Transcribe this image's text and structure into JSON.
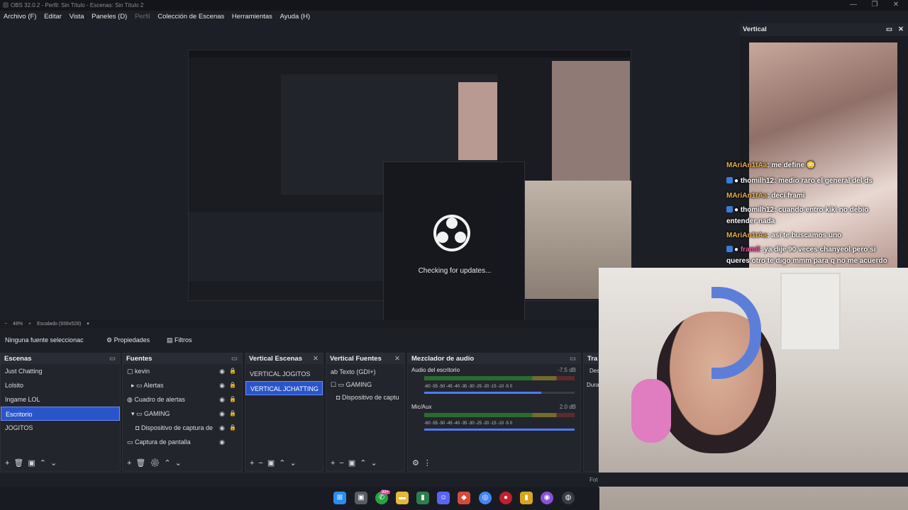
{
  "window": {
    "title": "OBS 32.0.2 - Perfil: Sin Título - Escenas: Sin Título 2",
    "controls": [
      "—",
      "❐",
      "✕"
    ]
  },
  "menu": {
    "items": [
      "Archivo (F)",
      "Editar",
      "Vista",
      "Paneles (D)",
      "Perfil",
      "Colección de Escenas",
      "Herramientas",
      "Ayuda (H)"
    ]
  },
  "dialog": {
    "text": "Checking for updates..."
  },
  "zoom": {
    "minus": "−",
    "value": "48%",
    "plus": "+",
    "scale": "Escalado (939x528)"
  },
  "source_bar": {
    "none_selected": "Ninguna fuente seleccionac",
    "properties": "Propiedades",
    "filters": "Filtros"
  },
  "scenes": {
    "title": "Escenas",
    "items": [
      "Just Chatting",
      "Lolsito",
      "Ingame LOL",
      "Escritorio",
      "JOGITOS"
    ],
    "selected": "Escritorio"
  },
  "sources": {
    "title": "Fuentes",
    "items": [
      "kevin",
      "Alertas",
      "Cuadro de alertas",
      "GAMING",
      "Dispositivo de captura de",
      "Captura de pantalla"
    ]
  },
  "vertical_scenes": {
    "title": "Vertical Escenas",
    "items": [
      "VERTICAL JOGITOS",
      "VERTICAL JCHATTING"
    ],
    "selected": "VERTICAL JCHATTING"
  },
  "vertical_sources": {
    "title": "Vertical Fuentes",
    "items": [
      "Texto (GDI+)",
      "GAMING",
      "Dispositivo de captu"
    ]
  },
  "mixer": {
    "title": "Mezclador de audio",
    "channels": [
      {
        "name": "Audio del escritorio",
        "db": "-7.5 dB",
        "level": 0.78
      },
      {
        "name": "Mic/Aux",
        "db": "2.0 dB",
        "level": 1.0
      }
    ],
    "scale": [
      "-60",
      "-55",
      "-50",
      "-45",
      "-40",
      "-35",
      "-30",
      "-25",
      "-20",
      "-15",
      "-10",
      "-5",
      "0"
    ]
  },
  "transitions": {
    "title": "Tra",
    "dest": "Des",
    "dura": "Dura"
  },
  "vertical_panel": {
    "title": "Vertical"
  },
  "chat": [
    {
      "user": "MAriAn1tAa",
      "msg": ": me define 😳",
      "kind": "u1"
    },
    {
      "user": "thomilh12",
      "msg": ": medio raro el general del ds",
      "kind": "u2"
    },
    {
      "user": "MAriAn1tAa",
      "msg": ": decí frami",
      "kind": "u1"
    },
    {
      "user": "thomilh12",
      "msg": ": cuando entro kiki no debio",
      "kind": "u2"
    },
    {
      "user": "",
      "msg": "entender nada",
      "kind": "u2"
    },
    {
      "user": "MAriAn1tAa",
      "msg": ": asi te buscamos uno",
      "kind": "u1"
    },
    {
      "user": "framil",
      "msg": ": ya dije 90 veces chanyeol pero si",
      "kind": "u2"
    },
    {
      "user": "",
      "msg": "queres otro te digo mmm para q no me acuerdo",
      "kind": "u2"
    }
  ],
  "taskbar": {
    "badge": "99+"
  },
  "status": {
    "fot": "Fot"
  },
  "colors": {
    "accent": "#2a54c9",
    "panel": "#23252d",
    "bg": "#1d1f26"
  }
}
